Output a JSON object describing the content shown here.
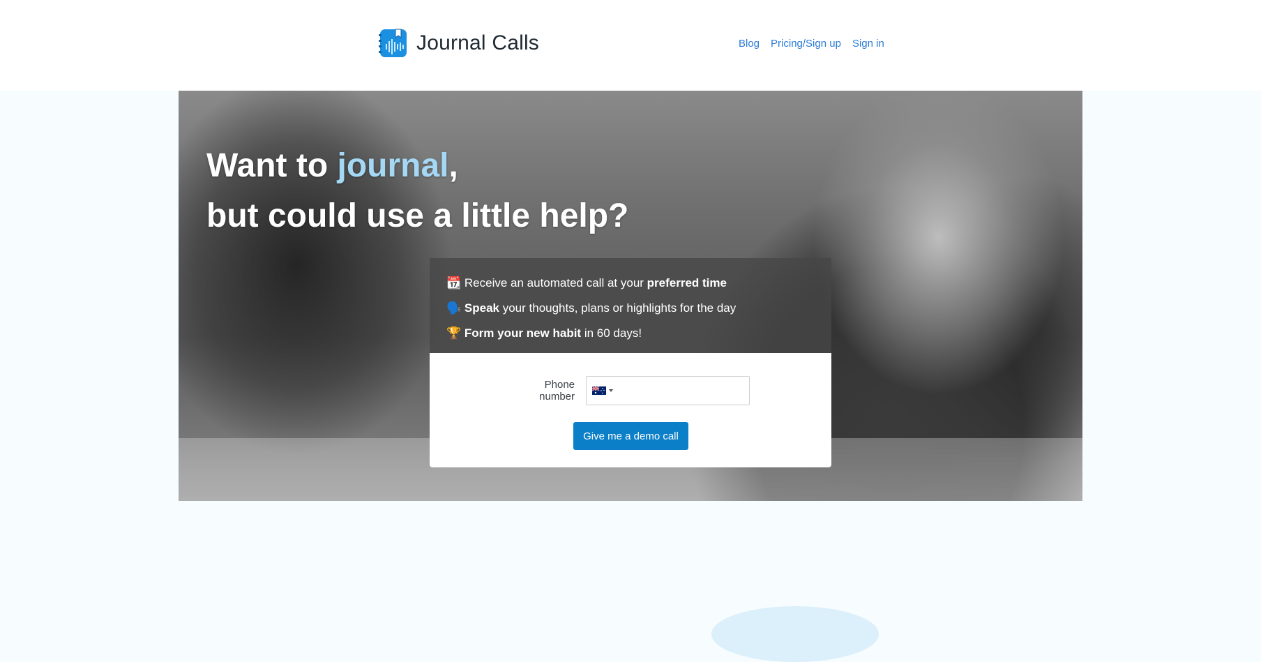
{
  "header": {
    "brand_name": "Journal Calls",
    "logo_icon": "journal-logo-icon",
    "nav": [
      {
        "label": "Blog"
      },
      {
        "label": "Pricing/Sign up"
      },
      {
        "label": "Sign in"
      }
    ]
  },
  "hero": {
    "title_prefix": "Want to ",
    "title_accent": "journal",
    "title_comma": ",",
    "title_line2": "but could use a little help?",
    "accent_color": "#a4d8f5"
  },
  "features": [
    {
      "emoji": "📆",
      "pre": " Receive an automated call at your ",
      "bold": "preferred time",
      "post": ""
    },
    {
      "emoji": "🗣️",
      "pre": " ",
      "bold": "Speak",
      "post": " your thoughts, plans or highlights for the day"
    },
    {
      "emoji": "🏆",
      "pre": " ",
      "bold": "Form your new habit",
      "post": " in 60 days!"
    }
  ],
  "form": {
    "phone_label": "Phone number",
    "phone_value": "",
    "country_flag_icon": "australia-flag-icon",
    "submit_label": "Give me a demo call",
    "button_color": "#0b7fc7"
  }
}
